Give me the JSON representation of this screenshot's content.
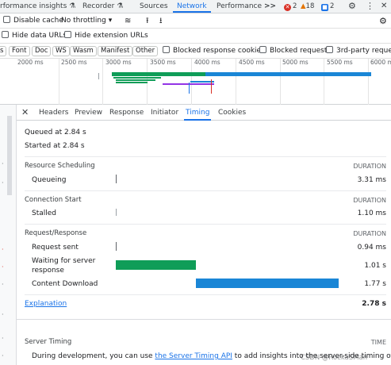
{
  "devtools_tabs": [
    {
      "label": "rformance insights",
      "icon": "flask-icon"
    },
    {
      "label": "Recorder",
      "icon": "flask-icon"
    },
    {
      "label": "Sources"
    },
    {
      "label": "Network"
    },
    {
      "label": "Performance"
    }
  ],
  "active_tab": "Network",
  "overflow_label": ">>",
  "issues": {
    "errors": "2",
    "warnings": "18",
    "info": "2"
  },
  "toolbar": {
    "disable_cache_label": "Disable cache",
    "throttling_label": "No throttling"
  },
  "filters": {
    "hide_data_urls": "Hide data URLs",
    "hide_extension_urls": "Hide extension URLs"
  },
  "type_chips": [
    "Font",
    "Doc",
    "WS",
    "Wasm",
    "Manifest",
    "Other"
  ],
  "type_chip_leading": "s",
  "checks": {
    "blocked_cookies": "Blocked response cookies",
    "blocked_requests": "Blocked requests",
    "third_party": "3rd-party requests"
  },
  "overview": {
    "ticks": [
      "2000 ms",
      "2500 ms",
      "3000 ms",
      "3500 ms",
      "4000 ms",
      "4500 ms",
      "5000 ms",
      "5500 ms",
      "6000 ms"
    ]
  },
  "detail_tabs": [
    "Headers",
    "Preview",
    "Response",
    "Initiator",
    "Timing",
    "Cookies"
  ],
  "active_detail_tab": "Timing",
  "timing": {
    "queued_at": "Queued at 2.84 s",
    "started_at": "Started at 2.84 s",
    "duration_header": "DURATION",
    "sections": [
      {
        "title": "Resource Scheduling",
        "rows": [
          {
            "label": "Queueing",
            "value": "3.31 ms"
          }
        ]
      },
      {
        "title": "Connection Start",
        "rows": [
          {
            "label": "Stalled",
            "value": "1.10 ms"
          }
        ]
      },
      {
        "title": "Request/Response",
        "rows": [
          {
            "label": "Request sent",
            "value": "0.94 ms"
          },
          {
            "label": "Waiting for server response",
            "value": "1.01 s"
          },
          {
            "label": "Content Download",
            "value": "1.77 s"
          }
        ]
      }
    ],
    "explanation_link": "Explanation",
    "total": "2.78 s",
    "server_timing_title": "Server Timing",
    "time_header": "TIME",
    "server_timing_prefix": "During development, you can use ",
    "server_timing_link": "the Server Timing API",
    "server_timing_suffix": " to add insights into the server-side timing of this request."
  },
  "watermark": "CSDN @RockaSMan",
  "colors": {
    "accent": "#1a73e8",
    "waiting": "#0f9d58",
    "download": "#1a86d6",
    "error": "#d93025",
    "warning": "#e37400"
  }
}
